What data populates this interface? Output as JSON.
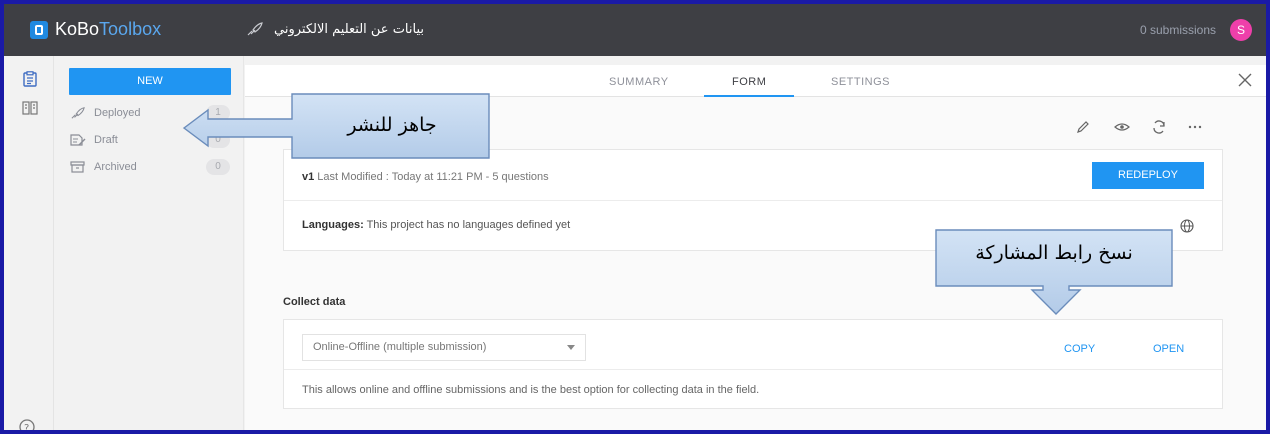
{
  "app": {
    "logo_part1": "KoBo",
    "logo_part2": "Toolbox",
    "project_title": "بيانات عن التعليم الالكتروني",
    "submissions": "0 submissions",
    "avatar_letter": "S"
  },
  "sidebar": {
    "new_label": "NEW",
    "items": [
      {
        "label": "Deployed",
        "count": "1",
        "icon": "rocket-icon"
      },
      {
        "label": "Draft",
        "count": "0",
        "icon": "draft-icon"
      },
      {
        "label": "Archived",
        "count": "0",
        "icon": "archive-icon"
      }
    ]
  },
  "tabs": [
    {
      "label": "SUMMARY",
      "active": false
    },
    {
      "label": "FORM",
      "active": true
    },
    {
      "label": "SETTINGS",
      "active": false
    }
  ],
  "form": {
    "version": "v1",
    "modified": " Last Modified : Today at 11:21 PM - 5 questions",
    "redeploy_label": "REDEPLOY",
    "languages_label": "Languages:",
    "languages_text": " This project has no languages defined yet"
  },
  "collect": {
    "heading": "Collect data",
    "selected_option": "Online-Offline (multiple submission)",
    "copy_label": "COPY",
    "open_label": "OPEN",
    "description": "This allows online and offline submissions and is the best option for collecting data in the field."
  },
  "callouts": {
    "deploy_note": "جاهز للنشر",
    "copy_note": "نسخ رابط المشاركة"
  },
  "colors": {
    "accent": "#2095f2",
    "topbar": "#3e3f44",
    "avatar": "#ee3faa",
    "frame_border": "#1a1aa6"
  }
}
